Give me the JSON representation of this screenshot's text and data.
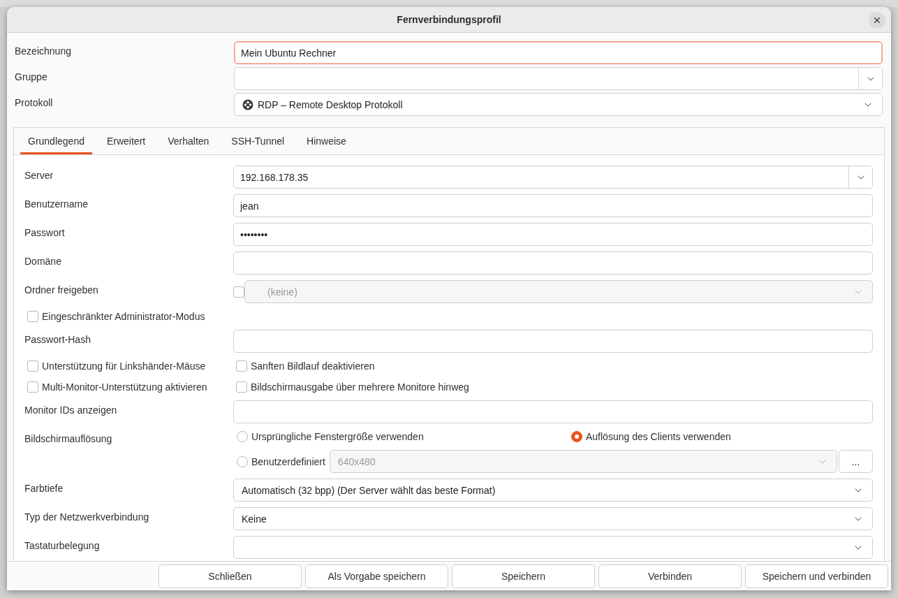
{
  "window": {
    "title": "Fernverbindungsprofil"
  },
  "header": [
    {
      "kind": "entry",
      "label": "Bezeichnung",
      "value": "Mein Ubuntu Rechner",
      "focused": true
    },
    {
      "kind": "combo-entry",
      "label": "Gruppe"
    },
    {
      "kind": "protocol",
      "label": "Protokoll",
      "value": "RDP – Remote Desktop Protokoll"
    }
  ],
  "tabs": [
    {
      "label": "Grundlegend",
      "selected": true
    },
    {
      "label": "Erweitert",
      "selected": false
    },
    {
      "label": "Verhalten",
      "selected": false
    },
    {
      "label": "SSH-Tunnel",
      "selected": false
    },
    {
      "label": "Hinweise",
      "selected": false
    }
  ],
  "rows": [
    {
      "kind": "combo-entry",
      "label": "Server",
      "value": "192.168.178.35"
    },
    {
      "kind": "entry",
      "label": "Benutzername",
      "value": "jean"
    },
    {
      "kind": "entry",
      "label": "Passwort",
      "value": "••••••••"
    },
    {
      "kind": "entry",
      "label": "Domäne"
    },
    {
      "kind": "share",
      "label": "Ordner freigeben",
      "checked": false,
      "value": "(keine)",
      "disabled": true
    },
    {
      "kind": "checkbox",
      "label": "Eingeschränkter Administrator-Modus",
      "checked": false
    },
    {
      "kind": "entry",
      "label": "Passwort-Hash"
    },
    {
      "kind": "checkbox-pair",
      "items": [
        {
          "label": "Unterstützung für Linkshänder-Mäuse",
          "checked": false
        },
        {
          "label": "Sanften Bildlauf deaktivieren",
          "checked": false
        }
      ]
    },
    {
      "kind": "checkbox-pair",
      "items": [
        {
          "label": "Multi-Monitor-Unterstützung aktivieren",
          "checked": false
        },
        {
          "label": "Bildschirmausgabe über mehrere Monitore hinweg",
          "checked": false
        }
      ]
    },
    {
      "kind": "entry",
      "label": "Monitor IDs anzeigen"
    },
    {
      "kind": "resolution",
      "label": "Bildschirmauflösung",
      "options": [
        {
          "label": "Ursprüngliche Fenstergröße verwenden",
          "selected": false
        },
        {
          "label": "Auflösung des Clients verwenden",
          "selected": true
        },
        {
          "label": "Benutzerdefiniert",
          "selected": false
        }
      ],
      "custom_value": "640x480",
      "custom_disabled": true,
      "more_button": "..."
    },
    {
      "kind": "combo",
      "label": "Farbtiefe",
      "value": "Automatisch (32 bpp) (Der Server wählt das beste Format)"
    },
    {
      "kind": "combo",
      "label": "Typ der Netzwerkverbindung",
      "value": "Keine"
    },
    {
      "kind": "combo",
      "label": "Tastaturbelegung"
    }
  ],
  "buttons": [
    "Schließen",
    "Als Vorgabe speichern",
    "Speichern",
    "Verbinden",
    "Speichern und verbinden"
  ]
}
